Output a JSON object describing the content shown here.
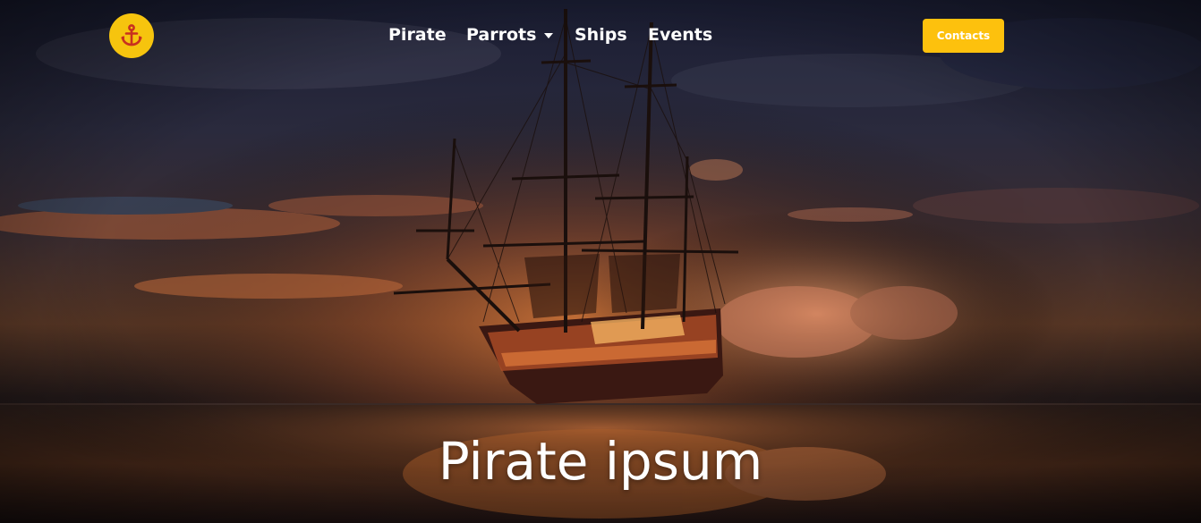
{
  "navbar": {
    "logo_icon": "anchor-icon",
    "items": [
      {
        "label": "Pirate"
      },
      {
        "label": "Parrots",
        "has_dropdown": true
      },
      {
        "label": "Ships"
      },
      {
        "label": "Events"
      }
    ],
    "contacts_label": "Contacts"
  },
  "hero": {
    "title": "Pirate ipsum",
    "background": "pirate-ship-sunset-image"
  },
  "colors": {
    "accent": "#fdc10d",
    "logo_bg": "#f6c40e",
    "anchor": "#c8311f",
    "text": "#ffffff"
  }
}
